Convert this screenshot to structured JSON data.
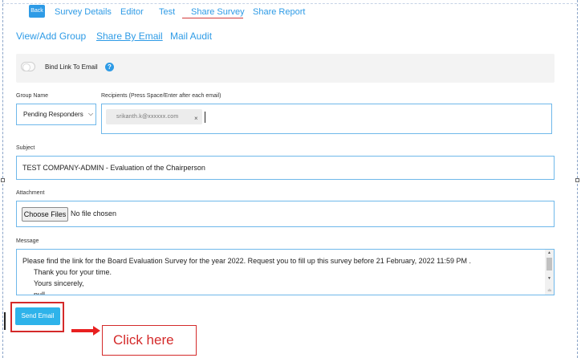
{
  "top_tabs": {
    "back": "Back",
    "items": [
      "Survey Details",
      "Editor",
      "Test",
      "Share Survey",
      "Share Report"
    ],
    "active": "Share Survey"
  },
  "sub_tabs": {
    "items": [
      "View/Add Group",
      "Share By Email",
      "Mail Audit"
    ],
    "active": "Share By Email"
  },
  "bind_link": {
    "label": "Bind Link To Email",
    "enabled": false,
    "help_icon": "question-circle-icon"
  },
  "form": {
    "group_name": {
      "label": "Group Name",
      "value": "Pending Responders"
    },
    "recipients": {
      "label": "Recipients (Press Space/Enter after each email)",
      "chips": [
        "srikanth.k@xxxxxx.com"
      ],
      "chip_remove": "×"
    },
    "subject": {
      "label": "Subject",
      "value": "TEST COMPANY-ADMIN - Evaluation of the Chairperson"
    },
    "attachment": {
      "label": "Attachment",
      "button": "Choose Files",
      "status": "No file chosen"
    },
    "message": {
      "label": "Message",
      "lines": [
        "Please find the link for the Board Evaluation Survey for the year 2022. Request you to fill up this survey before 21 February, 2022 11:59 PM .",
        "Thank you for your time.",
        "Yours sincerely,",
        "null"
      ]
    },
    "send_button": "Send Email"
  },
  "annotation": {
    "callout": "Click here",
    "color": "#d42a2a"
  },
  "colors": {
    "accent": "#2e9be6",
    "border": "#6fb8ea",
    "highlight": "#d42a2a"
  }
}
